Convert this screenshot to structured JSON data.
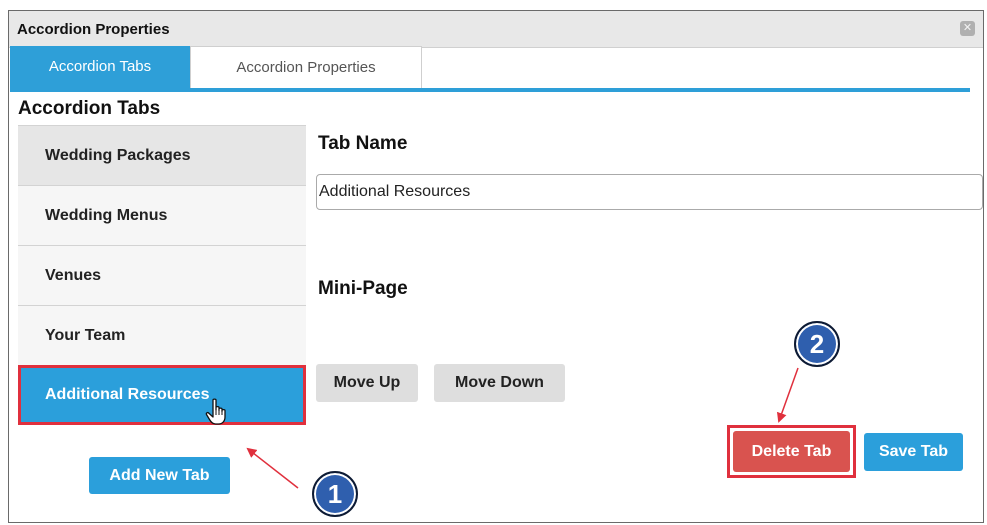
{
  "dialog": {
    "title": "Accordion Properties",
    "close_icon": "close-icon"
  },
  "tabs": [
    {
      "label": "Accordion Tabs",
      "active": true
    },
    {
      "label": "Accordion Properties",
      "active": false
    }
  ],
  "left_panel": {
    "heading": "Accordion Tabs",
    "items": [
      {
        "label": "Wedding Packages"
      },
      {
        "label": "Wedding Menus"
      },
      {
        "label": "Venues"
      },
      {
        "label": "Your Team"
      },
      {
        "label": "Additional Resources",
        "selected": true
      }
    ],
    "add_button": "Add New Tab"
  },
  "form": {
    "tab_name_label": "Tab Name",
    "tab_name_value": "Additional Resources",
    "mini_page_label": "Mini-Page",
    "move_up": "Move Up",
    "move_down": "Move Down",
    "delete": "Delete Tab",
    "save": "Save Tab"
  },
  "annotations": {
    "callout_1": "1",
    "callout_2": "2"
  },
  "colors": {
    "accent": "#2b9fdb",
    "danger": "#d9534f",
    "highlight": "#e0303d",
    "callout": "#2f5fae"
  }
}
